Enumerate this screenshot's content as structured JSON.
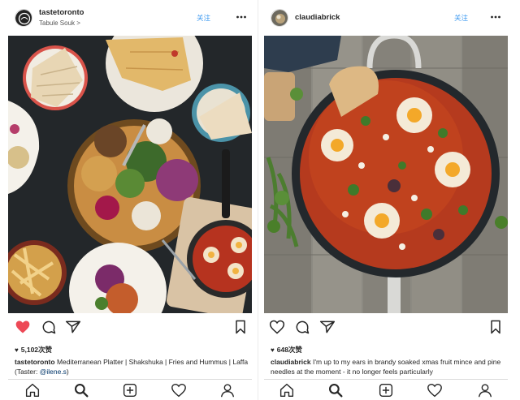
{
  "left_post": {
    "username": "tastetoronto",
    "location": "Tabule Souk",
    "location_chevron": ">",
    "follow_label": "关注",
    "more_icon": "more-horizontal-icon",
    "photo_subject": "Mediterranean platter and shakshuka on dark table",
    "liked": true,
    "like_color": "#ed4956",
    "likes_text": "5,102次赞",
    "caption_user": "tastetoronto",
    "caption_text": " Mediterranean Platter | Shakshuka | Fries and Hummus | Laffa (Taster: ",
    "caption_mention": "@ilene.s",
    "caption_end": ")"
  },
  "right_post": {
    "username": "claudiabrick",
    "follow_label": "关注",
    "more_icon": "more-horizontal-icon",
    "photo_subject": "Shakshuka in cast iron pan on wooden boards",
    "liked": false,
    "likes_text": "648次赞",
    "caption_user": "claudiabrick",
    "caption_text": " I'm up to my ears in brandy soaked xmas fruit mince and pine needles at the moment - it no longer feels particularly"
  },
  "tabbar": {
    "tabs": [
      "home-icon",
      "search-icon",
      "add-post-icon",
      "activity-heart-icon",
      "profile-icon"
    ],
    "active": "search-icon"
  },
  "colors": {
    "accent_blue": "#3897f0",
    "text": "#262626",
    "border": "#dbdbdb"
  }
}
